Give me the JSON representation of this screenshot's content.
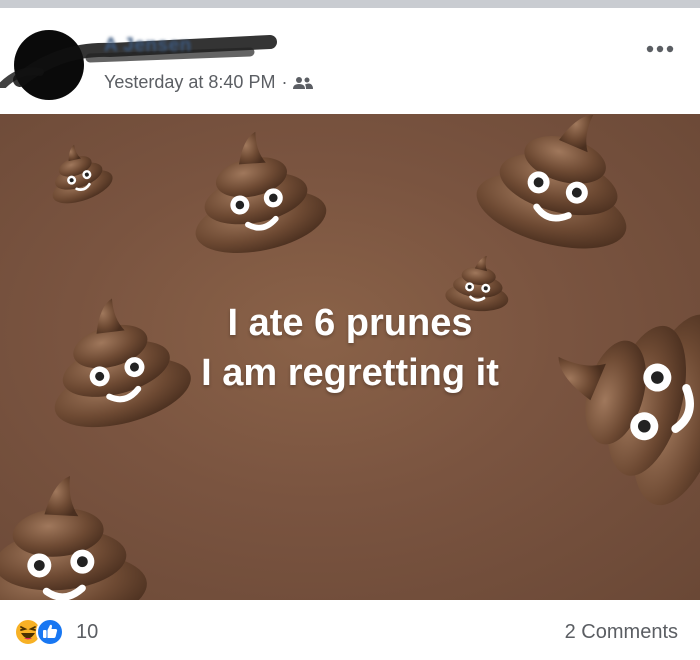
{
  "header": {
    "author_name": "A    Jensen",
    "timestamp": "Yesterday at 8:40 PM",
    "separator": "·",
    "audience_icon": "friends-icon",
    "more_icon": "more-options-icon"
  },
  "post": {
    "text_line_1": "I ate 6 prunes",
    "text_line_2": "I am regretting it",
    "background_color": "#7a5440",
    "emoji_icon": "pile-of-poo-emoji"
  },
  "footer": {
    "reaction_icons": [
      "laugh-reaction-icon",
      "like-reaction-icon"
    ],
    "reaction_count": "10",
    "comments_label": "2 Comments"
  }
}
